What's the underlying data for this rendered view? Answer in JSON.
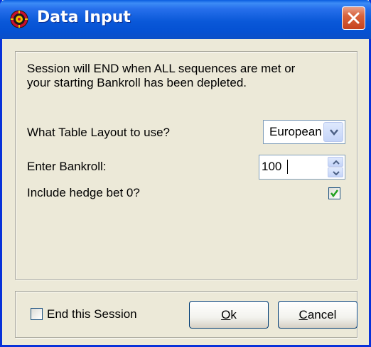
{
  "window": {
    "title": "Data Input",
    "icon": "roulette-wheel-icon",
    "close_icon": "close-icon",
    "colors": {
      "titlebar": "#0a58d8",
      "close": "#d8633c",
      "face": "#ece9d8"
    }
  },
  "main": {
    "message": "Session will END when ALL sequences are met or your starting Bankroll has been depleted.",
    "layout": {
      "label": "What Table Layout to use?",
      "selected": "European"
    },
    "bankroll": {
      "label": "Enter Bankroll:",
      "value": "100"
    },
    "hedge": {
      "label": "Include hedge bet 0?",
      "checked": true
    }
  },
  "footer": {
    "end_session": {
      "label": "End this Session",
      "checked": false
    },
    "ok": {
      "mnemonic": "O",
      "rest": "k"
    },
    "cancel": {
      "mnemonic": "C",
      "rest": "ancel"
    }
  }
}
